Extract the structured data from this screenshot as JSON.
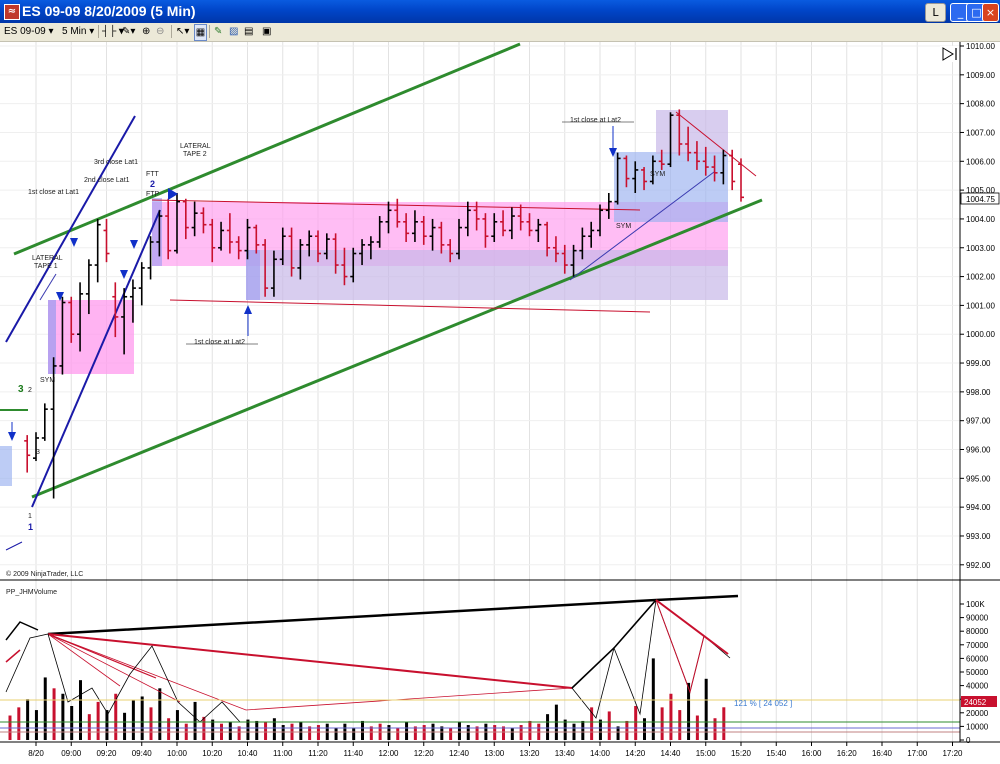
{
  "window": {
    "title": "ES 09-09  8/20/2009 (5 Min)",
    "icon": "chart-app-icon",
    "controls": [
      "L",
      "_",
      "□",
      "×"
    ]
  },
  "toolbar": {
    "instrument": "ES 09-09",
    "interval": "5 Min",
    "icons": [
      "bars-icon",
      "pencil-icon",
      "zoom-in-icon",
      "zoom-out-icon",
      "pointer-icon",
      "properties-icon",
      "strategy-icon",
      "indicator-icon",
      "data-box-icon"
    ]
  },
  "copyright": "© 2009 NinjaTrader, LLC",
  "price_marker": "1004.75",
  "volume_marker": "24052",
  "volume_readout": "121 % [ 24 052 ]",
  "volume_panel_title": "PP_JHMVolume",
  "annotations": {
    "lat1_first": "1st close at Lat1",
    "lat1_second": "2nd close Lat1",
    "lat1_third": "3rd close Lat1",
    "lateral_tape1_a": "LATERAL",
    "lateral_tape1_b": "TAPE 1",
    "lateral_tape2_a": "LATERAL",
    "lateral_tape2_b": "TAPE 2",
    "ftt": "FTT",
    "ftp": "FTP",
    "lat2_first_low": "1st close at Lat2",
    "lat2_first_high": "1st close at Lat2",
    "sym_1": "SYM",
    "sym_2": "SYM",
    "sym_3": "SYM",
    "point_1": "1",
    "point_1b": "1",
    "point_2": "2",
    "point_2b": "2",
    "point_3": "3",
    "point_3b": "3"
  },
  "colors": {
    "up_bar": "#000000",
    "down_bar": "#c8102e",
    "trend_channel": "#2e8b2e",
    "steep_channel": "#1a1aa8",
    "lateral_zone": "#ff88ee",
    "blue_zone": "#8c8cf0",
    "arrow": "#1030c8"
  },
  "chart_data": [
    {
      "type": "bar",
      "subtype": "ohlc",
      "title": "ES 09-09 (5 Min)",
      "ylim": [
        991.75,
        1010.0
      ],
      "y_ticks": [
        "1010.00",
        "1009.00",
        "1008.00",
        "1007.00",
        "1006.00",
        "1005.00",
        "1004.00",
        "1003.00",
        "1002.00",
        "1001.00",
        "1000.00",
        "999.00",
        "998.00",
        "997.00",
        "996.00",
        "995.00",
        "994.00",
        "993.00",
        "992.00"
      ],
      "x_ticks": [
        "8/20",
        "09:00",
        "09:20",
        "09:40",
        "10:00",
        "10:20",
        "10:40",
        "11:00",
        "11:20",
        "11:40",
        "12:00",
        "12:20",
        "12:40",
        "13:00",
        "13:20",
        "13:40",
        "14:00",
        "14:20",
        "14:40",
        "15:00",
        "15:20",
        "15:40",
        "16:00",
        "16:20",
        "16:40",
        "17:00",
        "17:20"
      ],
      "bars": [
        {
          "t": "08:35",
          "o": 996.3,
          "h": 996.5,
          "l": 995.2,
          "c": 995.8
        },
        {
          "t": "08:40",
          "o": 995.7,
          "h": 996.6,
          "l": 995.6,
          "c": 996.4
        },
        {
          "t": "08:45",
          "o": 996.4,
          "h": 997.6,
          "l": 996.3,
          "c": 997.4
        },
        {
          "t": "08:50",
          "o": 997.4,
          "h": 999.2,
          "l": 994.3,
          "c": 998.9
        },
        {
          "t": "08:55",
          "o": 998.9,
          "h": 1001.3,
          "l": 998.6,
          "c": 1001.1
        },
        {
          "t": "09:00",
          "o": 1001.1,
          "h": 1001.3,
          "l": 999.7,
          "c": 1000.0
        },
        {
          "t": "09:05",
          "o": 1000.0,
          "h": 1001.8,
          "l": 999.4,
          "c": 1001.4
        },
        {
          "t": "09:10",
          "o": 1001.4,
          "h": 1002.6,
          "l": 1000.7,
          "c": 1002.4
        },
        {
          "t": "09:15",
          "o": 1002.4,
          "h": 1004.0,
          "l": 1001.8,
          "c": 1003.8
        },
        {
          "t": "09:20",
          "o": 1003.6,
          "h": 1004.0,
          "l": 1002.5,
          "c": 1002.8
        },
        {
          "t": "09:25",
          "o": 1001.3,
          "h": 1001.8,
          "l": 999.9,
          "c": 1000.6
        },
        {
          "t": "09:30",
          "o": 1000.6,
          "h": 1001.6,
          "l": 999.3,
          "c": 1001.3
        },
        {
          "t": "09:35",
          "o": 1001.3,
          "h": 1001.9,
          "l": 1000.4,
          "c": 1001.6
        },
        {
          "t": "09:40",
          "o": 1001.6,
          "h": 1002.5,
          "l": 1001.0,
          "c": 1002.3
        },
        {
          "t": "09:45",
          "o": 1002.3,
          "h": 1003.4,
          "l": 1001.9,
          "c": 1003.2
        },
        {
          "t": "09:50",
          "o": 1003.2,
          "h": 1004.3,
          "l": 1002.7,
          "c": 1004.1
        },
        {
          "t": "09:55",
          "o": 1004.1,
          "h": 1004.7,
          "l": 1002.6,
          "c": 1002.9
        },
        {
          "t": "10:00",
          "o": 1002.9,
          "h": 1004.9,
          "l": 1002.8,
          "c": 1004.6
        },
        {
          "t": "10:05",
          "o": 1004.6,
          "h": 1004.7,
          "l": 1003.3,
          "c": 1003.7
        },
        {
          "t": "10:10",
          "o": 1003.7,
          "h": 1004.6,
          "l": 1003.4,
          "c": 1004.2
        },
        {
          "t": "10:15",
          "o": 1004.2,
          "h": 1004.4,
          "l": 1003.5,
          "c": 1003.8
        },
        {
          "t": "10:20",
          "o": 1003.8,
          "h": 1004.0,
          "l": 1002.5,
          "c": 1003.0
        },
        {
          "t": "10:25",
          "o": 1003.0,
          "h": 1003.9,
          "l": 1002.9,
          "c": 1003.6
        },
        {
          "t": "10:30",
          "o": 1003.6,
          "h": 1004.2,
          "l": 1002.8,
          "c": 1003.2
        },
        {
          "t": "10:35",
          "o": 1003.2,
          "h": 1003.4,
          "l": 1002.6,
          "c": 1002.9
        },
        {
          "t": "10:40",
          "o": 1002.9,
          "h": 1004.0,
          "l": 1002.6,
          "c": 1003.7
        },
        {
          "t": "10:45",
          "o": 1003.7,
          "h": 1003.8,
          "l": 1002.8,
          "c": 1003.1
        },
        {
          "t": "10:50",
          "o": 1003.1,
          "h": 1003.3,
          "l": 1001.3,
          "c": 1001.6
        },
        {
          "t": "10:55",
          "o": 1001.6,
          "h": 1002.9,
          "l": 1001.3,
          "c": 1002.6
        },
        {
          "t": "11:00",
          "o": 1002.6,
          "h": 1003.7,
          "l": 1002.4,
          "c": 1003.4
        },
        {
          "t": "11:05",
          "o": 1003.4,
          "h": 1003.7,
          "l": 1002.0,
          "c": 1002.3
        },
        {
          "t": "11:10",
          "o": 1002.3,
          "h": 1003.3,
          "l": 1001.9,
          "c": 1003.1
        },
        {
          "t": "11:15",
          "o": 1003.1,
          "h": 1003.6,
          "l": 1002.7,
          "c": 1003.4
        },
        {
          "t": "11:20",
          "o": 1003.4,
          "h": 1003.6,
          "l": 1002.5,
          "c": 1002.8
        },
        {
          "t": "11:25",
          "o": 1002.8,
          "h": 1003.5,
          "l": 1002.6,
          "c": 1003.3
        },
        {
          "t": "11:30",
          "o": 1003.3,
          "h": 1003.5,
          "l": 1002.1,
          "c": 1002.4
        },
        {
          "t": "11:35",
          "o": 1002.4,
          "h": 1003.0,
          "l": 1001.7,
          "c": 1002.0
        },
        {
          "t": "11:40",
          "o": 1002.0,
          "h": 1003.0,
          "l": 1001.8,
          "c": 1002.8
        },
        {
          "t": "11:45",
          "o": 1002.8,
          "h": 1003.3,
          "l": 1002.4,
          "c": 1003.1
        },
        {
          "t": "11:50",
          "o": 1003.1,
          "h": 1003.4,
          "l": 1002.6,
          "c": 1003.2
        },
        {
          "t": "11:55",
          "o": 1003.2,
          "h": 1004.1,
          "l": 1003.0,
          "c": 1003.9
        },
        {
          "t": "12:00",
          "o": 1003.9,
          "h": 1004.6,
          "l": 1003.5,
          "c": 1004.3
        },
        {
          "t": "12:05",
          "o": 1004.3,
          "h": 1004.7,
          "l": 1003.7,
          "c": 1003.9
        },
        {
          "t": "12:10",
          "o": 1003.9,
          "h": 1004.2,
          "l": 1003.2,
          "c": 1003.5
        },
        {
          "t": "12:15",
          "o": 1003.5,
          "h": 1004.3,
          "l": 1003.2,
          "c": 1003.9
        },
        {
          "t": "12:20",
          "o": 1003.9,
          "h": 1004.1,
          "l": 1003.1,
          "c": 1003.4
        },
        {
          "t": "12:25",
          "o": 1003.4,
          "h": 1004.0,
          "l": 1002.9,
          "c": 1003.7
        },
        {
          "t": "12:30",
          "o": 1003.7,
          "h": 1003.9,
          "l": 1002.8,
          "c": 1003.1
        },
        {
          "t": "12:35",
          "o": 1003.1,
          "h": 1003.3,
          "l": 1002.5,
          "c": 1002.8
        },
        {
          "t": "12:40",
          "o": 1002.8,
          "h": 1004.0,
          "l": 1002.6,
          "c": 1003.7
        },
        {
          "t": "12:45",
          "o": 1003.7,
          "h": 1004.6,
          "l": 1003.4,
          "c": 1004.3
        },
        {
          "t": "12:50",
          "o": 1004.3,
          "h": 1004.6,
          "l": 1003.6,
          "c": 1004.0
        },
        {
          "t": "12:55",
          "o": 1004.0,
          "h": 1004.2,
          "l": 1003.0,
          "c": 1003.4
        },
        {
          "t": "13:00",
          "o": 1003.4,
          "h": 1004.2,
          "l": 1003.2,
          "c": 1003.9
        },
        {
          "t": "13:05",
          "o": 1003.9,
          "h": 1004.3,
          "l": 1003.4,
          "c": 1003.6
        },
        {
          "t": "13:10",
          "o": 1003.6,
          "h": 1004.4,
          "l": 1003.3,
          "c": 1004.1
        },
        {
          "t": "13:15",
          "o": 1004.1,
          "h": 1004.5,
          "l": 1003.6,
          "c": 1003.9
        },
        {
          "t": "13:20",
          "o": 1003.9,
          "h": 1004.2,
          "l": 1003.4,
          "c": 1003.6
        },
        {
          "t": "13:25",
          "o": 1003.6,
          "h": 1004.0,
          "l": 1003.2,
          "c": 1003.8
        },
        {
          "t": "13:30",
          "o": 1003.8,
          "h": 1003.9,
          "l": 1002.7,
          "c": 1003.0
        },
        {
          "t": "13:35",
          "o": 1003.0,
          "h": 1003.4,
          "l": 1002.5,
          "c": 1002.8
        },
        {
          "t": "13:40",
          "o": 1002.8,
          "h": 1003.1,
          "l": 1002.1,
          "c": 1002.4
        },
        {
          "t": "13:45",
          "o": 1002.4,
          "h": 1003.1,
          "l": 1002.0,
          "c": 1002.9
        },
        {
          "t": "13:50",
          "o": 1002.9,
          "h": 1003.7,
          "l": 1002.6,
          "c": 1003.4
        },
        {
          "t": "13:55",
          "o": 1003.4,
          "h": 1003.9,
          "l": 1003.0,
          "c": 1003.6
        },
        {
          "t": "14:00",
          "o": 1003.6,
          "h": 1004.5,
          "l": 1003.4,
          "c": 1004.3
        },
        {
          "t": "14:05",
          "o": 1004.3,
          "h": 1004.9,
          "l": 1004.0,
          "c": 1004.6
        },
        {
          "t": "14:10",
          "o": 1004.6,
          "h": 1006.3,
          "l": 1004.5,
          "c": 1006.1
        },
        {
          "t": "14:15",
          "o": 1006.1,
          "h": 1006.2,
          "l": 1005.1,
          "c": 1005.4
        },
        {
          "t": "14:20",
          "o": 1005.4,
          "h": 1006.0,
          "l": 1004.9,
          "c": 1005.7
        },
        {
          "t": "14:25",
          "o": 1005.7,
          "h": 1005.8,
          "l": 1005.0,
          "c": 1005.3
        },
        {
          "t": "14:30",
          "o": 1005.3,
          "h": 1006.2,
          "l": 1005.2,
          "c": 1006.0
        },
        {
          "t": "14:35",
          "o": 1006.0,
          "h": 1006.4,
          "l": 1005.7,
          "c": 1005.9
        },
        {
          "t": "14:40",
          "o": 1005.9,
          "h": 1007.7,
          "l": 1005.8,
          "c": 1007.6
        },
        {
          "t": "14:45",
          "o": 1007.6,
          "h": 1007.8,
          "l": 1006.2,
          "c": 1006.6
        },
        {
          "t": "14:50",
          "o": 1006.6,
          "h": 1007.2,
          "l": 1006.0,
          "c": 1006.3
        },
        {
          "t": "14:55",
          "o": 1006.3,
          "h": 1006.7,
          "l": 1005.7,
          "c": 1006.0
        },
        {
          "t": "15:00",
          "o": 1006.0,
          "h": 1006.5,
          "l": 1005.5,
          "c": 1005.8
        },
        {
          "t": "15:05",
          "o": 1005.8,
          "h": 1006.2,
          "l": 1005.3,
          "c": 1005.6
        },
        {
          "t": "15:10",
          "o": 1005.6,
          "h": 1006.4,
          "l": 1005.2,
          "c": 1006.2
        },
        {
          "t": "15:15",
          "o": 1006.2,
          "h": 1006.4,
          "l": 1005.0,
          "c": 1005.3
        },
        {
          "t": "15:20",
          "o": 1005.9,
          "h": 1006.1,
          "l": 1004.6,
          "c": 1004.75
        }
      ]
    },
    {
      "type": "bar",
      "title": "PP_JHMVolume",
      "ylim": [
        0,
        100000
      ],
      "y_ticks": [
        "100K",
        "90000",
        "80000",
        "70000",
        "60000",
        "50000",
        "40000",
        "30000",
        "20000",
        "10000",
        "0"
      ],
      "volumes": [
        18000,
        24000,
        30000,
        22000,
        46000,
        38000,
        34000,
        25000,
        44000,
        19000,
        28000,
        22000,
        34000,
        20000,
        29000,
        32000,
        24000,
        38000,
        16000,
        22000,
        12000,
        28000,
        17000,
        15000,
        12000,
        13000,
        10000,
        15000,
        14000,
        13000,
        16000,
        11000,
        12000,
        13000,
        10000,
        11000,
        12000,
        9000,
        12000,
        9000,
        14000,
        10000,
        12000,
        11000,
        9000,
        13000,
        10000,
        11000,
        12000,
        10000,
        9000,
        13000,
        11000,
        10000,
        12000,
        11000,
        10000,
        9000,
        11000,
        14000,
        12000,
        19000,
        26000,
        15000,
        12000,
        14000,
        24000,
        15000,
        21000,
        10000,
        14000,
        25000,
        16000,
        60000,
        24000,
        34000,
        22000,
        42000,
        18000,
        45000,
        16000,
        24052
      ],
      "up_down": [
        "d",
        "d",
        "u",
        "u",
        "u",
        "d",
        "u",
        "u",
        "u",
        "d",
        "d",
        "u",
        "d",
        "u",
        "u",
        "u",
        "d",
        "u",
        "d",
        "u",
        "d",
        "u",
        "d",
        "u",
        "d",
        "u",
        "d",
        "u",
        "u",
        "d",
        "u",
        "u",
        "d",
        "u",
        "d",
        "d",
        "u",
        "u",
        "u",
        "u",
        "u",
        "d",
        "d",
        "u",
        "d",
        "u",
        "d",
        "d",
        "u",
        "u",
        "d",
        "u",
        "u",
        "d",
        "u",
        "d",
        "d",
        "u",
        "d",
        "d",
        "d",
        "u",
        "u",
        "u",
        "u",
        "u",
        "d",
        "u",
        "d",
        "u",
        "d",
        "d",
        "u",
        "u",
        "d",
        "d",
        "d",
        "u",
        "d",
        "u",
        "d",
        "d"
      ]
    }
  ]
}
